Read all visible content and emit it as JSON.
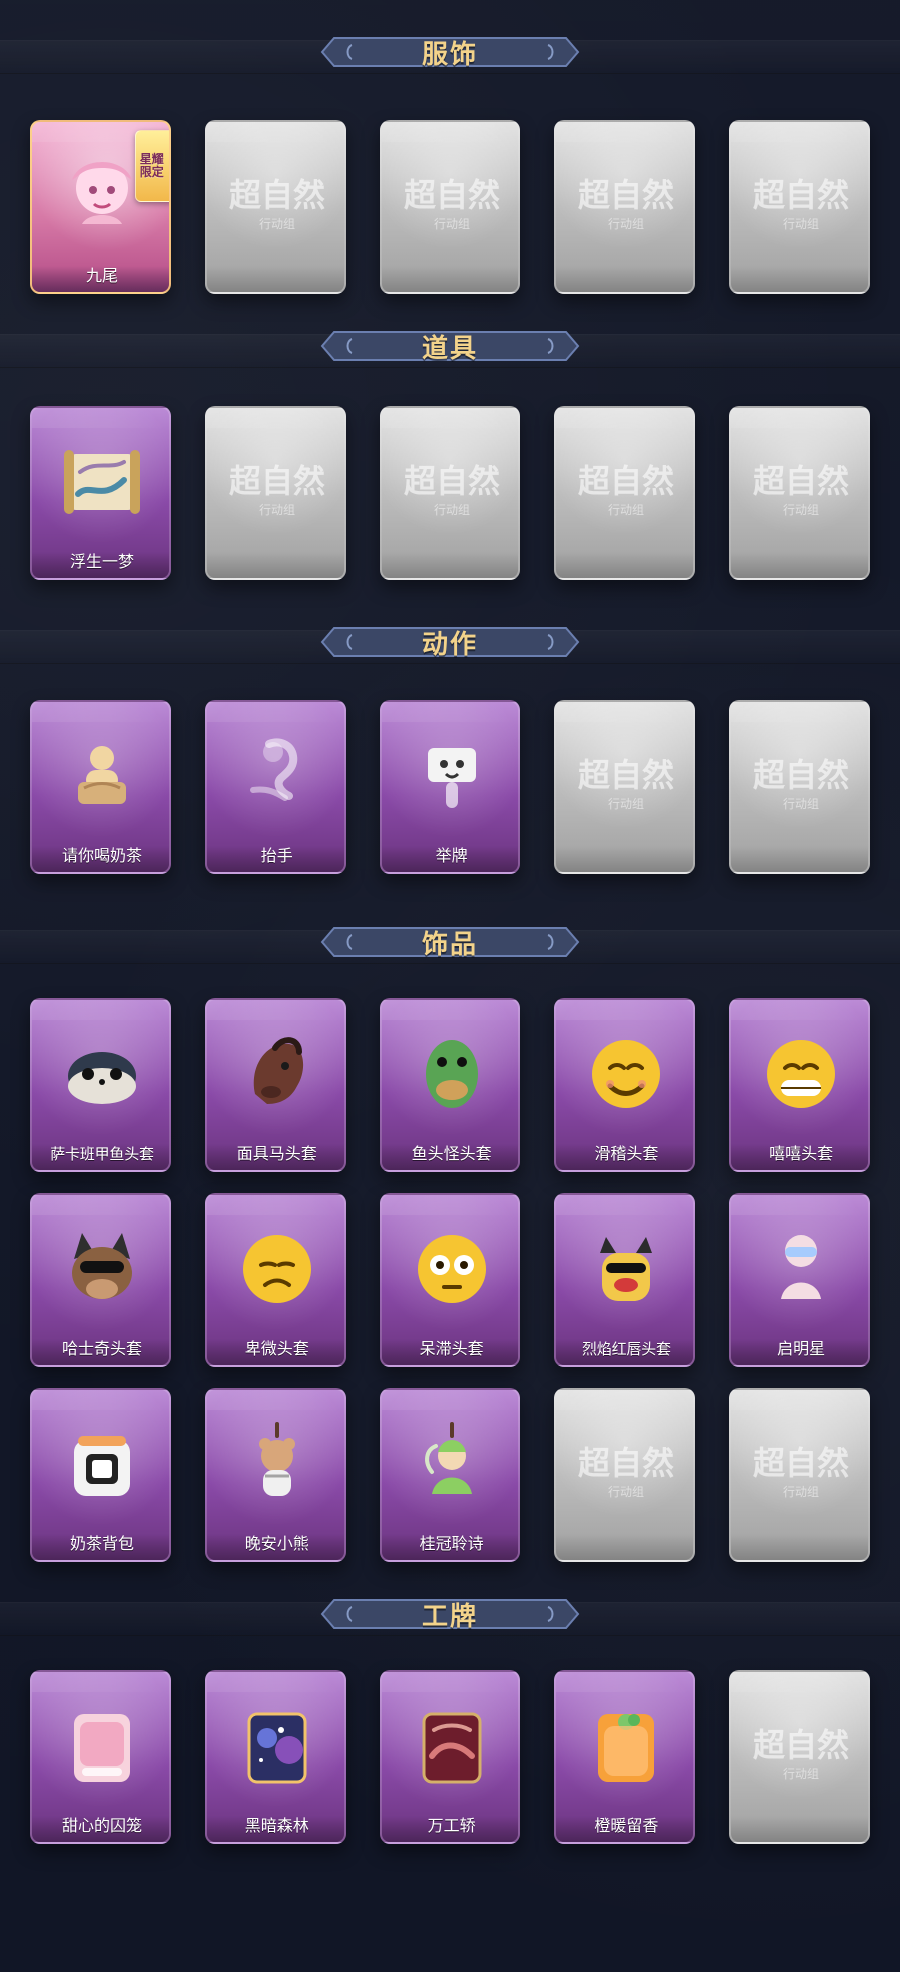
{
  "sections": [
    {
      "title": "服饰",
      "items": [
        {
          "label": "九尾",
          "variant": "pink",
          "icon": "nine-tails-portrait-icon",
          "badge": "星耀限定"
        },
        {
          "label": "",
          "variant": "gray",
          "icon": "placeholder-watermark-icon"
        },
        {
          "label": "",
          "variant": "gray",
          "icon": "placeholder-watermark-icon"
        },
        {
          "label": "",
          "variant": "gray",
          "icon": "placeholder-watermark-icon"
        },
        {
          "label": "",
          "variant": "gray",
          "icon": "placeholder-watermark-icon"
        }
      ]
    },
    {
      "title": "道具",
      "items": [
        {
          "label": "浮生一梦",
          "variant": "purple",
          "icon": "scroll-icon"
        },
        {
          "label": "",
          "variant": "gray",
          "icon": "placeholder-watermark-icon"
        },
        {
          "label": "",
          "variant": "gray",
          "icon": "placeholder-watermark-icon"
        },
        {
          "label": "",
          "variant": "gray",
          "icon": "placeholder-watermark-icon"
        },
        {
          "label": "",
          "variant": "gray",
          "icon": "placeholder-watermark-icon"
        }
      ]
    },
    {
      "title": "动作",
      "items": [
        {
          "label": "请你喝奶茶",
          "variant": "purple",
          "icon": "milk-tea-gesture-icon"
        },
        {
          "label": "抬手",
          "variant": "purple",
          "icon": "raise-hand-icon"
        },
        {
          "label": "举牌",
          "variant": "purple",
          "icon": "hold-sign-icon"
        },
        {
          "label": "",
          "variant": "gray",
          "icon": "placeholder-watermark-icon"
        },
        {
          "label": "",
          "variant": "gray",
          "icon": "placeholder-watermark-icon"
        }
      ]
    },
    {
      "title": "饰品",
      "rows": [
        [
          {
            "label": "萨卡班甲鱼头套",
            "variant": "purple",
            "icon": "fish-headgear-icon",
            "small": true
          },
          {
            "label": "面具马头套",
            "variant": "purple",
            "icon": "horse-mask-icon"
          },
          {
            "label": "鱼头怪头套",
            "variant": "purple",
            "icon": "fish-monster-mask-icon"
          },
          {
            "label": "滑稽头套",
            "variant": "purple",
            "icon": "smile-face-icon"
          },
          {
            "label": "嘻嘻头套",
            "variant": "purple",
            "icon": "grin-face-icon"
          }
        ],
        [
          {
            "label": "哈士奇头套",
            "variant": "purple",
            "icon": "husky-mask-icon"
          },
          {
            "label": "卑微头套",
            "variant": "purple",
            "icon": "humble-face-icon"
          },
          {
            "label": "呆滞头套",
            "variant": "purple",
            "icon": "dazed-face-icon"
          },
          {
            "label": "烈焰红唇头套",
            "variant": "purple",
            "icon": "lips-mask-icon",
            "small": true
          },
          {
            "label": "启明星",
            "variant": "purple",
            "icon": "mannequin-glasses-icon"
          }
        ],
        [
          {
            "label": "奶茶背包",
            "variant": "purple",
            "icon": "milk-tea-backpack-icon"
          },
          {
            "label": "晚安小熊",
            "variant": "purple",
            "icon": "bear-charm-icon"
          },
          {
            "label": "桂冠聆诗",
            "variant": "purple",
            "icon": "fairy-charm-icon"
          },
          {
            "label": "",
            "variant": "gray",
            "icon": "placeholder-watermark-icon"
          },
          {
            "label": "",
            "variant": "gray",
            "icon": "placeholder-watermark-icon"
          }
        ]
      ]
    },
    {
      "title": "工牌",
      "items": [
        {
          "label": "甜心的囚笼",
          "variant": "purple",
          "icon": "badge-card-icon"
        },
        {
          "label": "黑暗森林",
          "variant": "purple",
          "icon": "galaxy-card-icon"
        },
        {
          "label": "万工轿",
          "variant": "purple",
          "icon": "red-card-icon"
        },
        {
          "label": "橙暖留香",
          "variant": "purple",
          "icon": "orange-card-icon"
        },
        {
          "label": "",
          "variant": "gray",
          "icon": "placeholder-watermark-icon"
        }
      ]
    }
  ],
  "watermark": {
    "line1": "超自然",
    "line2": "行动组"
  }
}
